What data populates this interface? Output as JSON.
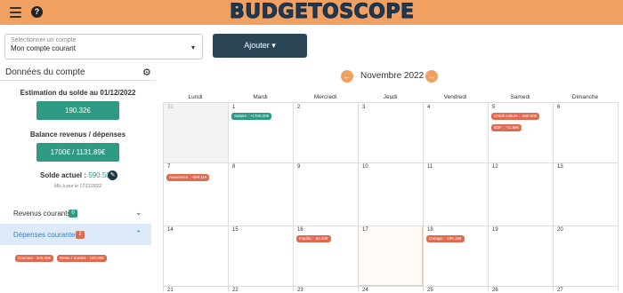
{
  "header": {
    "logo": "BUDGETOSCOPE",
    "help_label": "?"
  },
  "account": {
    "label": "Sélectionner un compte",
    "value": "Mon compte courant"
  },
  "add_button": "Ajouter ▾",
  "sidebar": {
    "title": "Données du compte",
    "estimation_label": "Estimation du solde au 01/12/2022",
    "estimation_value": "190.32€",
    "balance_label": "Balance revenus / dépenses",
    "balance_value": "1700€ / 1131.89€",
    "solde_label": "Solde actuel :",
    "solde_value": "590.50€",
    "maj": "Mis à jour le 17/11/2022",
    "revenus_label": "Revenus courants",
    "revenus_count": "0",
    "depenses_label": "Dépenses courantes",
    "depenses_count": "2",
    "depenses_items": [
      "Courses - 300.00€",
      "Resto / Sorties - 150.00€"
    ]
  },
  "calendar": {
    "month": "Novembre 2022",
    "days": [
      "Lundi",
      "Mardi",
      "Mercredi",
      "Jeudi",
      "Vendredi",
      "Samedi",
      "Dimanche"
    ],
    "weeks": [
      [
        "31",
        "1",
        "2",
        "3",
        "4",
        "5",
        "6"
      ],
      [
        "7",
        "8",
        "9",
        "10",
        "11",
        "12",
        "13"
      ],
      [
        "14",
        "15",
        "16",
        "17",
        "18",
        "19",
        "20"
      ],
      [
        "21",
        "22",
        "23",
        "24",
        "25",
        "26",
        "27"
      ]
    ],
    "events": {
      "salaire": "Salaire : +1700.00€",
      "credit": "Crédit voiture : -250.00€",
      "edf": "EDF : -71.89€",
      "assurance": "Assurance : -509.11€",
      "impots": "Impôts : -60.00€",
      "garage": "Garage : -190.16€"
    }
  },
  "colors": {
    "accent": "#f0a060",
    "teal": "#2e9a83",
    "red": "#e06a50",
    "dark": "#2a4656"
  }
}
